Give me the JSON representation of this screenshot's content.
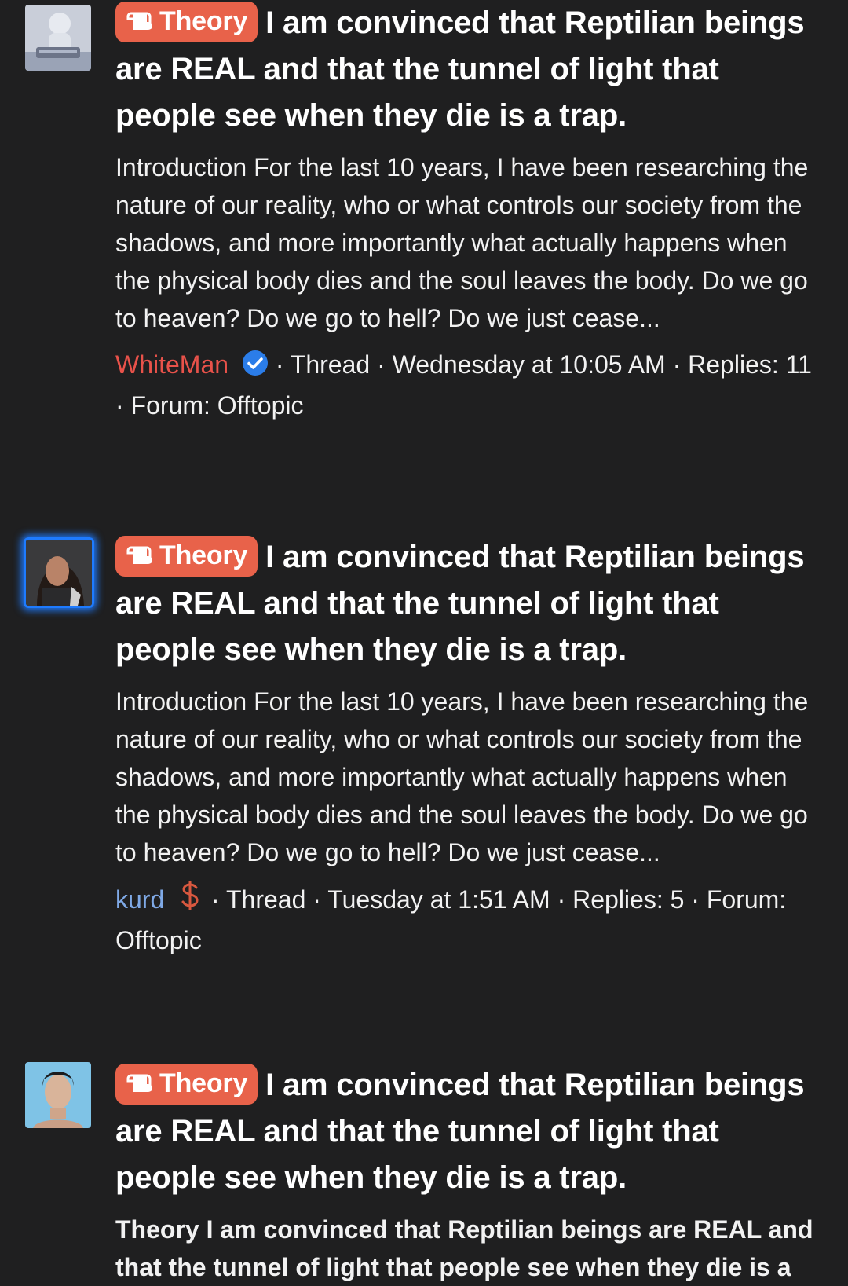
{
  "prefix_label": "Theory",
  "colors": {
    "background": "#1f1f20",
    "prefix": "#e8624a",
    "verified": "#2b7de9",
    "user_red": "#e8524a",
    "user_blue": "#7fa9e6"
  },
  "results": [
    {
      "avatar": "robot-avatar",
      "title": "I am convinced that Reptilian beings are REAL and that the tunnel of light that people see when they die is a trap.",
      "snippet": "Introduction For the last 10 years, I have been researching the nature of our reality, who or what controls our society from the shadows, and more importantly what actually happens when the physical body dies and the soul leaves the body. Do we go to heaven? Do we go to hell? Do we just cease...",
      "username": "WhiteMan",
      "badge": "verified-check-icon",
      "meta": "· Thread · Wednesday at 10:05 AM · Replies: 11 · Forum: Offtopic"
    },
    {
      "avatar": "woman-avatar",
      "title": "I am convinced that Reptilian beings are REAL and that the tunnel of light that people see when they die is a trap.",
      "snippet": "Introduction For the last 10 years, I have been researching the nature of our reality, who or what controls our society from the shadows, and more importantly what actually happens when the physical body dies and the soul leaves the body. Do we go to heaven? Do we go to hell? Do we just cease...",
      "username": "kurd",
      "badge": "dollar-icon",
      "meta": "· Thread · Tuesday at 1:51 AM · Replies: 5 · Forum: Offtopic"
    },
    {
      "avatar": "man-avatar",
      "title": "I am convinced that Reptilian beings are REAL and that the tunnel of light that people see when they die is a trap.",
      "snippet": "Theory I am convinced that Reptilian beings are REAL and that the tunnel of light that people see when they die is a"
    }
  ]
}
